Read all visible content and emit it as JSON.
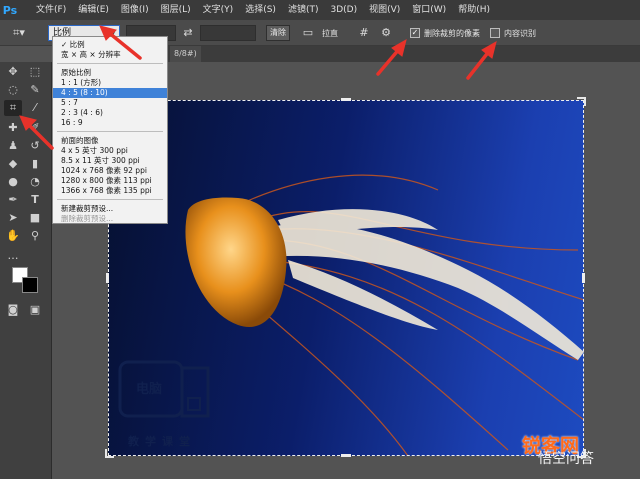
{
  "menubar": {
    "logo": "Ps",
    "items": [
      "文件(F)",
      "编辑(E)",
      "图像(I)",
      "图层(L)",
      "文字(Y)",
      "选择(S)",
      "滤镜(T)",
      "3D(D)",
      "视图(V)",
      "窗口(W)",
      "帮助(H)"
    ]
  },
  "options": {
    "ratio_value": "比例",
    "clear_label": "清除",
    "straighten_label": "拉直",
    "delete_cropped_label": "删除裁剪的像素",
    "delete_cropped_checked": "✓",
    "content_aware_label": "内容识别"
  },
  "tab": {
    "title": "8/8#)"
  },
  "dropdown": {
    "items": [
      {
        "label": "✓ 比例",
        "state": "normal"
      },
      {
        "label": "宽 × 高 × 分辨率",
        "state": "normal"
      },
      {
        "label": "原始比例",
        "state": "normal"
      },
      {
        "label": "1 : 1 (方形)",
        "state": "normal"
      },
      {
        "label": "4 : 5 (8 : 10)",
        "state": "selected"
      },
      {
        "label": "5 : 7",
        "state": "normal"
      },
      {
        "label": "2 : 3 (4 : 6)",
        "state": "normal"
      },
      {
        "label": "16 : 9",
        "state": "normal"
      },
      {
        "label": "前面的图像",
        "state": "normal"
      },
      {
        "label": "4 x 5 英寸 300 ppi",
        "state": "normal"
      },
      {
        "label": "8.5 x 11 英寸 300 ppi",
        "state": "normal"
      },
      {
        "label": "1024 x 768 像素 92 ppi",
        "state": "normal"
      },
      {
        "label": "1280 x 800 像素 113 ppi",
        "state": "normal"
      },
      {
        "label": "1366 x 768 像素 135 ppi",
        "state": "normal"
      },
      {
        "label": "新建裁剪预设...",
        "state": "normal"
      },
      {
        "label": "删除裁剪预设...",
        "state": "disabled"
      }
    ]
  },
  "watermark": {
    "logo_text": "电脑",
    "caption": "教学课堂"
  },
  "site_mark": {
    "brand": "锐客网",
    "caption": "悟空问答"
  },
  "colors": {
    "arrow": "#e8322a",
    "accent": "#3f82d8"
  }
}
